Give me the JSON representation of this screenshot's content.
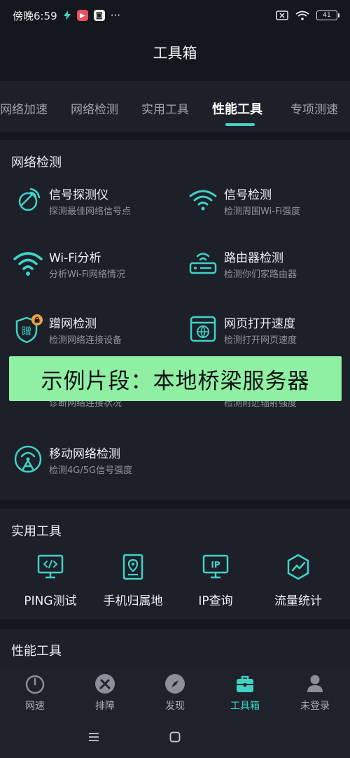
{
  "status_bar": {
    "time": "傍晚6:59",
    "battery": "41"
  },
  "header": {
    "title": "工具箱"
  },
  "tabs": [
    {
      "label": "网络加速"
    },
    {
      "label": "网络检测"
    },
    {
      "label": "实用工具"
    },
    {
      "label": "性能工具",
      "active": true
    },
    {
      "label": "专项测速"
    }
  ],
  "network_section": {
    "title": "网络检测",
    "items": [
      {
        "title": "信号探测仪",
        "subtitle": "探测最佳网络信号点",
        "icon": "satellite-dish-icon"
      },
      {
        "title": "信号检测",
        "subtitle": "检测周围Wi-Fi强度",
        "icon": "wifi-signal-icon"
      },
      {
        "title": "Wi-Fi分析",
        "subtitle": "分析Wi-Fi网络情况",
        "icon": "wifi-icon"
      },
      {
        "title": "路由器检测",
        "subtitle": "检测你们家路由器",
        "icon": "router-icon"
      },
      {
        "title": "蹭网检测",
        "subtitle": "检测网络连接设备",
        "icon": "shield-lock-icon",
        "badge": "蹭"
      },
      {
        "title": "网页打开速度",
        "subtitle": "检测打开网页速度",
        "icon": "browser-globe-icon"
      },
      {
        "title": "移动网络检测",
        "subtitle": "检测4G/5G信号强度",
        "icon": "cell-tower-icon"
      }
    ],
    "partially_hidden": {
      "left_subtitle": "诊断网络连接状况",
      "right_subtitle": "检测附近辐射强度"
    }
  },
  "banner": {
    "text": "示例片段：本地桥梁服务器"
  },
  "utility_section": {
    "title": "实用工具",
    "items": [
      {
        "label": "PING测试",
        "icon": "code-monitor-icon"
      },
      {
        "label": "手机归属地",
        "icon": "location-book-icon"
      },
      {
        "label": "IP查询",
        "icon": "ip-monitor-icon",
        "icon_text": "IP"
      },
      {
        "label": "流量统计",
        "icon": "traffic-chart-icon"
      }
    ]
  },
  "performance_section": {
    "title": "性能工具"
  },
  "bottom_nav": [
    {
      "label": "网速",
      "icon": "speedometer-icon"
    },
    {
      "label": "排障",
      "icon": "tools-icon"
    },
    {
      "label": "发现",
      "icon": "compass-icon"
    },
    {
      "label": "工具箱",
      "icon": "toolbox-icon",
      "active": true
    },
    {
      "label": "未登录",
      "icon": "user-icon"
    }
  ],
  "colors": {
    "accent": "#3fd3c6",
    "background": "#15171e",
    "card": "#1d2029",
    "banner": "#8ff0a4"
  }
}
